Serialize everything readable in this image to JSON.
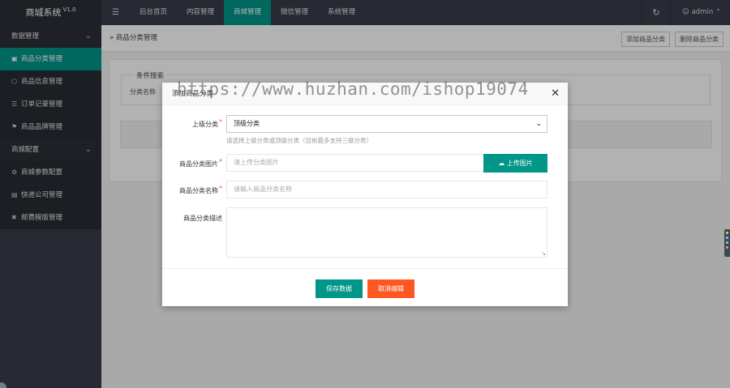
{
  "app": {
    "title": "商城系统",
    "version": "V1.0"
  },
  "topnav": {
    "menu_icon": "menu-icon",
    "items": [
      {
        "label": "后台首页",
        "active": false
      },
      {
        "label": "内容管理",
        "active": false
      },
      {
        "label": "商城管理",
        "active": true
      },
      {
        "label": "微信管理",
        "active": false
      },
      {
        "label": "系统管理",
        "active": false
      }
    ],
    "refresh_icon": "refresh-icon",
    "user": {
      "name": "admin",
      "icon": "user-icon"
    }
  },
  "sidebar": {
    "groups": [
      {
        "label": "数据管理",
        "items": [
          {
            "label": "商品分类管理",
            "icon": "document-icon",
            "active": true
          },
          {
            "label": "商品信息管理",
            "icon": "cube-icon",
            "active": false
          },
          {
            "label": "订单记录管理",
            "icon": "layers-icon",
            "active": false
          },
          {
            "label": "商品品牌管理",
            "icon": "flag-icon",
            "active": false
          }
        ]
      },
      {
        "label": "商城配置",
        "items": [
          {
            "label": "商城参数配置",
            "icon": "gear-icon",
            "active": false
          },
          {
            "label": "快递公司管理",
            "icon": "list-icon",
            "active": false
          },
          {
            "label": "邮费模版管理",
            "icon": "tools-icon",
            "active": false
          }
        ]
      }
    ]
  },
  "content": {
    "breadcrumb": "商品分类管理",
    "add_button": "添加商品分类",
    "delete_button": "删除商品分类",
    "search": {
      "legend": "条件搜索",
      "field_label": "分类名称"
    }
  },
  "modal": {
    "title": "添加商品分类",
    "parent": {
      "label": "上级分类",
      "value": "顶级分类",
      "hint": "请选择上级分类或顶级分类（目前最多支持三级分类）"
    },
    "image": {
      "label": "商品分类图片",
      "placeholder": "请上传分类图片",
      "upload_label": "上传图片"
    },
    "name": {
      "label": "商品分类名称",
      "placeholder": "请输入商品分类名称"
    },
    "desc": {
      "label": "商品分类描述"
    },
    "save_label": "保存数据",
    "cancel_label": "取消编辑"
  },
  "watermark": "https://www.huzhan.com/ishop19074",
  "colors": {
    "primary": "#009688",
    "danger": "#ff5722",
    "header": "#393d49"
  }
}
